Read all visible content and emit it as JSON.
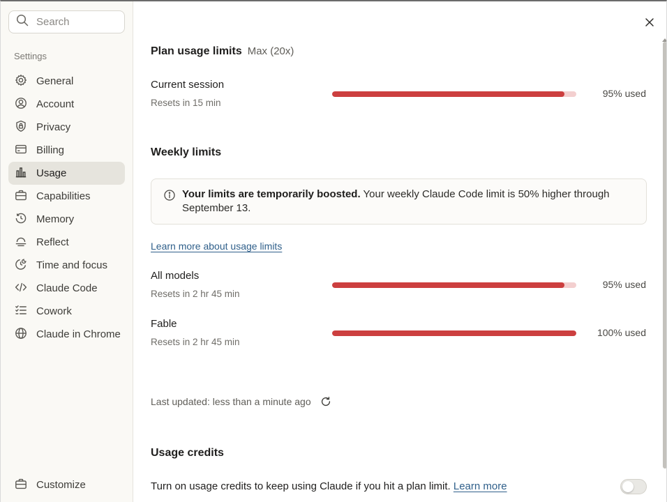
{
  "sidebar": {
    "search_placeholder": "Search",
    "section_label": "Settings",
    "items": [
      {
        "label": "General",
        "icon": "gear-icon"
      },
      {
        "label": "Account",
        "icon": "user-circle-icon"
      },
      {
        "label": "Privacy",
        "icon": "shield-lock-icon"
      },
      {
        "label": "Billing",
        "icon": "credit-card-icon"
      },
      {
        "label": "Usage",
        "icon": "bar-chart-icon",
        "active": true
      },
      {
        "label": "Capabilities",
        "icon": "briefcase-icon"
      },
      {
        "label": "Memory",
        "icon": "history-icon"
      },
      {
        "label": "Reflect",
        "icon": "reflect-icon"
      },
      {
        "label": "Time and focus",
        "icon": "clock-moon-icon"
      },
      {
        "label": "Claude Code",
        "icon": "code-icon"
      },
      {
        "label": "Cowork",
        "icon": "checklist-icon"
      },
      {
        "label": "Claude in Chrome",
        "icon": "globe-icon"
      }
    ],
    "customize_label": "Customize"
  },
  "main": {
    "plan": {
      "title": "Plan usage limits",
      "badge": "Max (20x)",
      "current_session": {
        "label": "Current session",
        "resets": "Resets in 15 min",
        "percent": 95,
        "percent_label": "95% used"
      }
    },
    "weekly": {
      "title": "Weekly limits",
      "notice_bold": "Your limits are temporarily boosted.",
      "notice_text": " Your weekly Claude Code limit is 50% higher through September 13.",
      "learn_link": "Learn more about usage limits",
      "all_models": {
        "label": "All models",
        "resets": "Resets in 2 hr 45 min",
        "percent": 95,
        "percent_label": "95% used"
      },
      "fable": {
        "label": "Fable",
        "resets": "Resets in 2 hr 45 min",
        "percent": 100,
        "percent_label": "100% used"
      }
    },
    "last_updated": "Last updated: less than a minute ago",
    "credits": {
      "title": "Usage credits",
      "text": "Turn on usage credits to keep using Claude if you hit a plan limit.",
      "link": "Learn more",
      "enabled": false
    }
  },
  "colors": {
    "bar_fill": "#cc3f3f",
    "bar_track": "#f3cfcf",
    "link": "#2f5f8a",
    "sidebar_bg": "#faf9f5",
    "active_bg": "#e6e4dd"
  }
}
